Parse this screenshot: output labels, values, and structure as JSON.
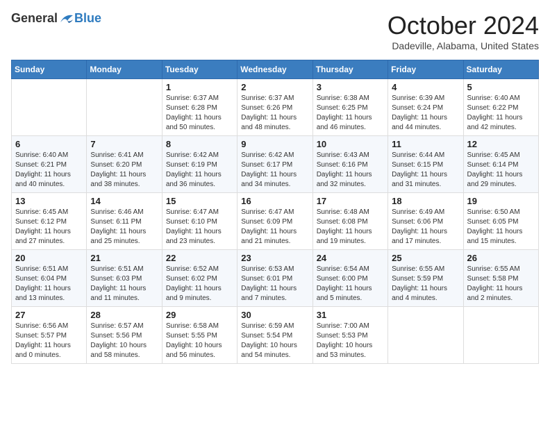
{
  "header": {
    "logo_general": "General",
    "logo_blue": "Blue",
    "month_title": "October 2024",
    "subtitle": "Dadeville, Alabama, United States"
  },
  "days_of_week": [
    "Sunday",
    "Monday",
    "Tuesday",
    "Wednesday",
    "Thursday",
    "Friday",
    "Saturday"
  ],
  "weeks": [
    [
      {
        "day": "",
        "text": ""
      },
      {
        "day": "",
        "text": ""
      },
      {
        "day": "1",
        "text": "Sunrise: 6:37 AM\nSunset: 6:28 PM\nDaylight: 11 hours and 50 minutes."
      },
      {
        "day": "2",
        "text": "Sunrise: 6:37 AM\nSunset: 6:26 PM\nDaylight: 11 hours and 48 minutes."
      },
      {
        "day": "3",
        "text": "Sunrise: 6:38 AM\nSunset: 6:25 PM\nDaylight: 11 hours and 46 minutes."
      },
      {
        "day": "4",
        "text": "Sunrise: 6:39 AM\nSunset: 6:24 PM\nDaylight: 11 hours and 44 minutes."
      },
      {
        "day": "5",
        "text": "Sunrise: 6:40 AM\nSunset: 6:22 PM\nDaylight: 11 hours and 42 minutes."
      }
    ],
    [
      {
        "day": "6",
        "text": "Sunrise: 6:40 AM\nSunset: 6:21 PM\nDaylight: 11 hours and 40 minutes."
      },
      {
        "day": "7",
        "text": "Sunrise: 6:41 AM\nSunset: 6:20 PM\nDaylight: 11 hours and 38 minutes."
      },
      {
        "day": "8",
        "text": "Sunrise: 6:42 AM\nSunset: 6:19 PM\nDaylight: 11 hours and 36 minutes."
      },
      {
        "day": "9",
        "text": "Sunrise: 6:42 AM\nSunset: 6:17 PM\nDaylight: 11 hours and 34 minutes."
      },
      {
        "day": "10",
        "text": "Sunrise: 6:43 AM\nSunset: 6:16 PM\nDaylight: 11 hours and 32 minutes."
      },
      {
        "day": "11",
        "text": "Sunrise: 6:44 AM\nSunset: 6:15 PM\nDaylight: 11 hours and 31 minutes."
      },
      {
        "day": "12",
        "text": "Sunrise: 6:45 AM\nSunset: 6:14 PM\nDaylight: 11 hours and 29 minutes."
      }
    ],
    [
      {
        "day": "13",
        "text": "Sunrise: 6:45 AM\nSunset: 6:12 PM\nDaylight: 11 hours and 27 minutes."
      },
      {
        "day": "14",
        "text": "Sunrise: 6:46 AM\nSunset: 6:11 PM\nDaylight: 11 hours and 25 minutes."
      },
      {
        "day": "15",
        "text": "Sunrise: 6:47 AM\nSunset: 6:10 PM\nDaylight: 11 hours and 23 minutes."
      },
      {
        "day": "16",
        "text": "Sunrise: 6:47 AM\nSunset: 6:09 PM\nDaylight: 11 hours and 21 minutes."
      },
      {
        "day": "17",
        "text": "Sunrise: 6:48 AM\nSunset: 6:08 PM\nDaylight: 11 hours and 19 minutes."
      },
      {
        "day": "18",
        "text": "Sunrise: 6:49 AM\nSunset: 6:06 PM\nDaylight: 11 hours and 17 minutes."
      },
      {
        "day": "19",
        "text": "Sunrise: 6:50 AM\nSunset: 6:05 PM\nDaylight: 11 hours and 15 minutes."
      }
    ],
    [
      {
        "day": "20",
        "text": "Sunrise: 6:51 AM\nSunset: 6:04 PM\nDaylight: 11 hours and 13 minutes."
      },
      {
        "day": "21",
        "text": "Sunrise: 6:51 AM\nSunset: 6:03 PM\nDaylight: 11 hours and 11 minutes."
      },
      {
        "day": "22",
        "text": "Sunrise: 6:52 AM\nSunset: 6:02 PM\nDaylight: 11 hours and 9 minutes."
      },
      {
        "day": "23",
        "text": "Sunrise: 6:53 AM\nSunset: 6:01 PM\nDaylight: 11 hours and 7 minutes."
      },
      {
        "day": "24",
        "text": "Sunrise: 6:54 AM\nSunset: 6:00 PM\nDaylight: 11 hours and 5 minutes."
      },
      {
        "day": "25",
        "text": "Sunrise: 6:55 AM\nSunset: 5:59 PM\nDaylight: 11 hours and 4 minutes."
      },
      {
        "day": "26",
        "text": "Sunrise: 6:55 AM\nSunset: 5:58 PM\nDaylight: 11 hours and 2 minutes."
      }
    ],
    [
      {
        "day": "27",
        "text": "Sunrise: 6:56 AM\nSunset: 5:57 PM\nDaylight: 11 hours and 0 minutes."
      },
      {
        "day": "28",
        "text": "Sunrise: 6:57 AM\nSunset: 5:56 PM\nDaylight: 10 hours and 58 minutes."
      },
      {
        "day": "29",
        "text": "Sunrise: 6:58 AM\nSunset: 5:55 PM\nDaylight: 10 hours and 56 minutes."
      },
      {
        "day": "30",
        "text": "Sunrise: 6:59 AM\nSunset: 5:54 PM\nDaylight: 10 hours and 54 minutes."
      },
      {
        "day": "31",
        "text": "Sunrise: 7:00 AM\nSunset: 5:53 PM\nDaylight: 10 hours and 53 minutes."
      },
      {
        "day": "",
        "text": ""
      },
      {
        "day": "",
        "text": ""
      }
    ]
  ]
}
